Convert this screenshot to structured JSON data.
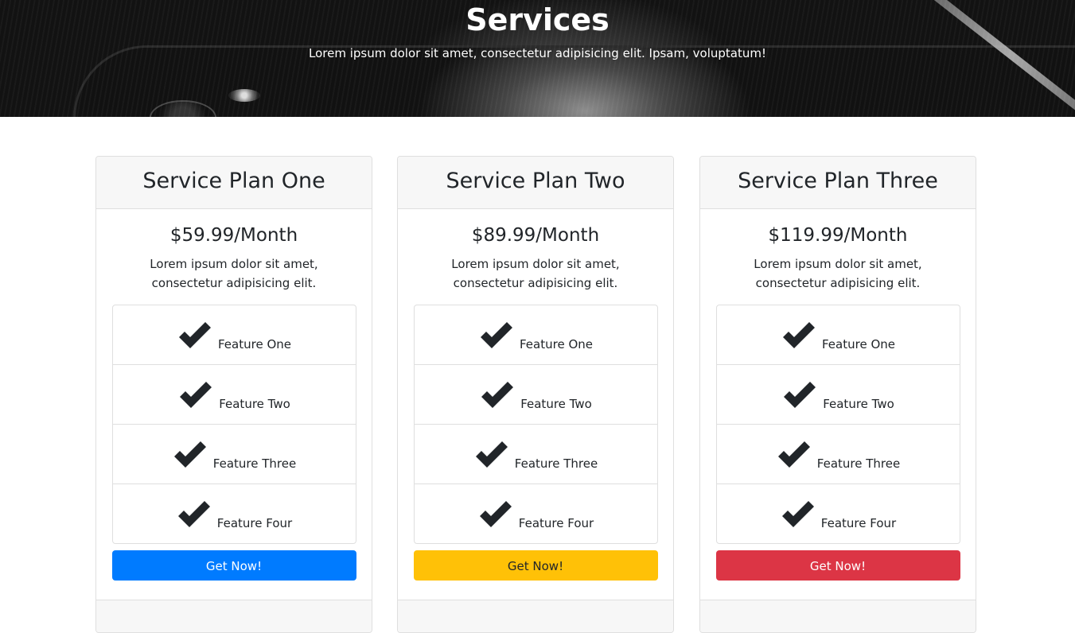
{
  "hero": {
    "title": "Services",
    "subtitle": "Lorem ipsum dolor sit amet, consectetur adipisicing elit. Ipsam, voluptatum!"
  },
  "plans": [
    {
      "name": "Service Plan One",
      "price": "$59.99/Month",
      "description": "Lorem ipsum dolor sit amet, consectetur adipisicing elit.",
      "features": [
        "Feature One",
        "Feature Two",
        "Feature Three",
        "Feature Four"
      ],
      "button_label": "Get Now!",
      "button_color": "#007bff",
      "button_text_color": "#ffffff"
    },
    {
      "name": "Service Plan Two",
      "price": "$89.99/Month",
      "description": "Lorem ipsum dolor sit amet, consectetur adipisicing elit.",
      "features": [
        "Feature One",
        "Feature Two",
        "Feature Three",
        "Feature Four"
      ],
      "button_label": "Get Now!",
      "button_color": "#ffc107",
      "button_text_color": "#212529"
    },
    {
      "name": "Service Plan Three",
      "price": "$119.99/Month",
      "description": "Lorem ipsum dolor sit amet, consectetur adipisicing elit.",
      "features": [
        "Feature One",
        "Feature Two",
        "Feature Three",
        "Feature Four"
      ],
      "button_label": "Get Now!",
      "button_color": "#dc3545",
      "button_text_color": "#ffffff"
    }
  ],
  "icons": {
    "feature_icon": "check-icon"
  }
}
